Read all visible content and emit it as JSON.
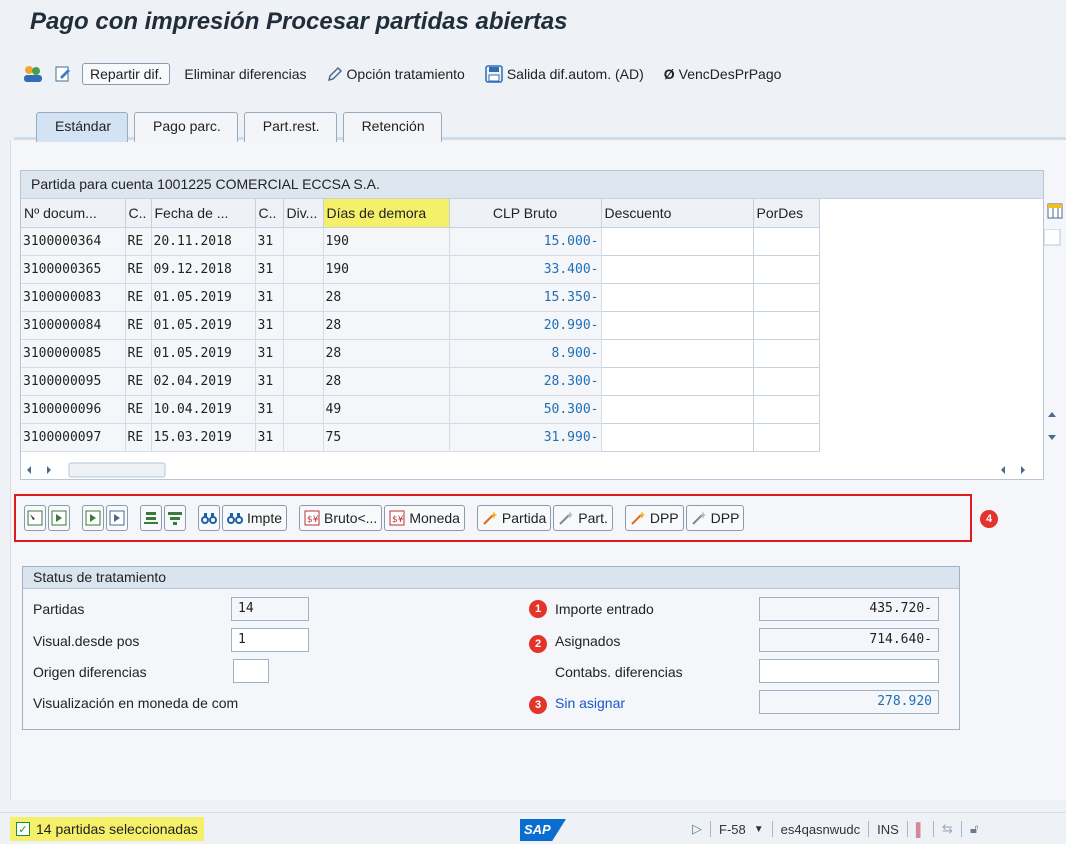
{
  "title": "Pago con impresión Procesar partidas abiertas",
  "toolbar": {
    "repartir_label": "Repartir dif.",
    "eliminar_label": "Eliminar diferencias",
    "opcion_label": "Opción tratamiento",
    "salida_label": "Salida dif.autom. (AD)",
    "venc_label": "VencDesPrPago"
  },
  "tabs": [
    {
      "label": "Estándar",
      "active": true
    },
    {
      "label": "Pago parc."
    },
    {
      "label": "Part.rest."
    },
    {
      "label": "Retención"
    }
  ],
  "grid": {
    "title": "Partida para cuenta 1001225 COMERCIAL ECCSA S.A.",
    "columns": [
      "Nº docum...",
      "C..",
      "Fecha de ...",
      "C..",
      "Div...",
      "Días de demora",
      "CLP Bruto",
      "Descuento",
      "PorDes"
    ],
    "rows": [
      [
        "3100000364",
        "RE",
        "20.11.2018",
        "31",
        "",
        "190",
        "15.000-",
        "",
        ""
      ],
      [
        "3100000365",
        "RE",
        "09.12.2018",
        "31",
        "",
        "190",
        "33.400-",
        "",
        ""
      ],
      [
        "3100000083",
        "RE",
        "01.05.2019",
        "31",
        "",
        "28",
        "15.350-",
        "",
        ""
      ],
      [
        "3100000084",
        "RE",
        "01.05.2019",
        "31",
        "",
        "28",
        "20.990-",
        "",
        ""
      ],
      [
        "3100000085",
        "RE",
        "01.05.2019",
        "31",
        "",
        "28",
        "8.900-",
        "",
        ""
      ],
      [
        "3100000095",
        "RE",
        "02.04.2019",
        "31",
        "",
        "28",
        "28.300-",
        "",
        ""
      ],
      [
        "3100000096",
        "RE",
        "10.04.2019",
        "31",
        "",
        "49",
        "50.300-",
        "",
        ""
      ],
      [
        "3100000097",
        "RE",
        "15.03.2019",
        "31",
        "",
        "75",
        "31.990-",
        "",
        ""
      ]
    ]
  },
  "buttons": {
    "impte": "Impte",
    "bruto": "Bruto<...",
    "moneda": "Moneda",
    "partida": "Partida",
    "part": "Part.",
    "dpp1": "DPP",
    "dpp2": "DPP",
    "badge4": "4"
  },
  "status": {
    "header": "Status de tratamiento",
    "partidas_label": "Partidas",
    "partidas_value": "14",
    "visual_label": "Visual.desde pos",
    "visual_value": "1",
    "origen_label": "Origen diferencias",
    "visualizacion_label": "Visualización en moneda de com",
    "importe_label": "Importe entrado",
    "importe_value": "435.720-",
    "asignados_label": "Asignados",
    "asignados_value": "714.640-",
    "contabs_label": "Contabs. diferencias",
    "sin_asignar_label": "Sin asignar",
    "sin_asignar_value": "278.920",
    "badge1": "1",
    "badge2": "2",
    "badge3": "3"
  },
  "statusbar": {
    "message": "14 partidas seleccionadas",
    "logo": "SAP",
    "transaction": "F-58",
    "system": "es4qasnwudc",
    "mode": "INS"
  }
}
